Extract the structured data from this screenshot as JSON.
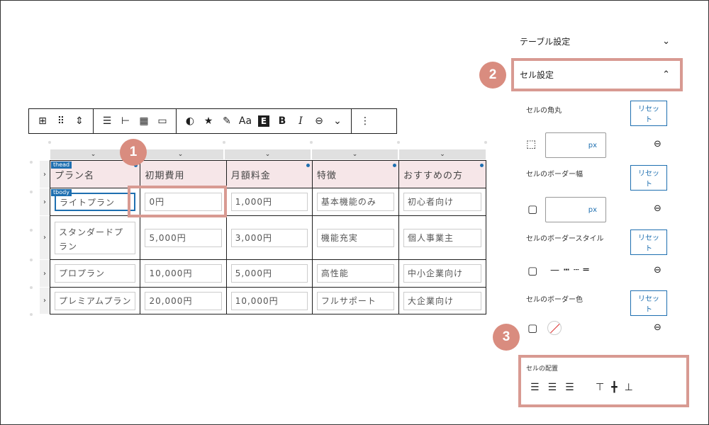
{
  "toolbar": {
    "buttons": [
      "table-block-icon",
      "drag-handle-icon",
      "move-updown-icon",
      "align-icon",
      "align-left-icon",
      "table-edit-icon",
      "caption-icon",
      "color-icon",
      "star-icon",
      "pen-icon",
      "text-size",
      "style-e",
      "bold",
      "italic",
      "link-icon",
      "more-chevron",
      "more-menu-icon"
    ],
    "aa_label": "Aa",
    "e_label": "E",
    "bold_label": "B",
    "italic_label": "I"
  },
  "table": {
    "head_badge": "thead",
    "body_badge": "tbody",
    "headers": [
      "プラン名",
      "初期費用",
      "月額料金",
      "特徴",
      "おすすめの方"
    ],
    "rows": [
      [
        "ライトプラン",
        "0円",
        "1,000円",
        "基本機能のみ",
        "初心者向け"
      ],
      [
        "スタンダードプラン",
        "5,000円",
        "3,000円",
        "機能充実",
        "個人事業主"
      ],
      [
        "プロプラン",
        "10,000円",
        "5,000円",
        "高性能",
        "中小企業向け"
      ],
      [
        "プレミアムプラン",
        "20,000円",
        "10,000円",
        "フルサポート",
        "大企業向け"
      ]
    ]
  },
  "sidebar": {
    "table_settings": "テーブル設定",
    "cell_settings": "セル設定",
    "cell_radius": "セルの角丸",
    "border_width": "セルのボーダー幅",
    "border_style": "セルのボーダースタイル",
    "border_color": "セルのボーダー色",
    "cell_alignment": "セルの配置",
    "reset": "リセット",
    "unit": "px"
  },
  "callouts": [
    "1",
    "2",
    "3"
  ],
  "colors": {
    "accent": "#1e6fb0",
    "highlight": "#d89a92",
    "callout": "#d98c7f",
    "head_bg": "#f6e6e8"
  }
}
